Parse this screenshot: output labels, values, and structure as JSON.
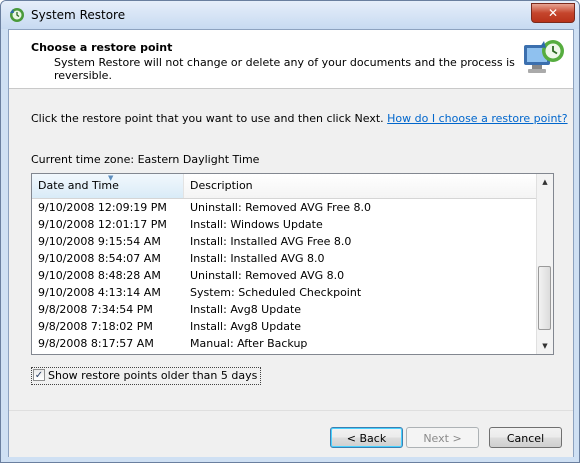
{
  "window": {
    "title": "System Restore",
    "close_label": "✕"
  },
  "header": {
    "title": "Choose a restore point",
    "subtitle": "System Restore will not change or delete any of your documents and the process is reversible."
  },
  "instruction": {
    "text": "Click the restore point that you want to use and then click Next.",
    "link": "How do I choose a restore point?"
  },
  "timezone": "Current time zone: Eastern Daylight Time",
  "table": {
    "columns": [
      "Date and Time",
      "Description"
    ],
    "rows": [
      {
        "date": "9/10/2008 12:09:19 PM",
        "desc": "Uninstall: Removed AVG Free 8.0"
      },
      {
        "date": "9/10/2008 12:01:17 PM",
        "desc": "Install: Windows Update"
      },
      {
        "date": "9/10/2008 9:15:54 AM",
        "desc": "Install: Installed AVG Free 8.0"
      },
      {
        "date": "9/10/2008 8:54:07 AM",
        "desc": "Install: Installed AVG 8.0"
      },
      {
        "date": "9/10/2008 8:48:28 AM",
        "desc": "Uninstall: Removed AVG 8.0"
      },
      {
        "date": "9/10/2008 4:13:14 AM",
        "desc": "System: Scheduled Checkpoint"
      },
      {
        "date": "9/8/2008 7:34:54 PM",
        "desc": "Install: Avg8 Update"
      },
      {
        "date": "9/8/2008 7:18:02 PM",
        "desc": "Install: Avg8 Update"
      },
      {
        "date": "9/8/2008 8:17:57 AM",
        "desc": "Manual: After Backup"
      }
    ]
  },
  "show_older": {
    "label": "Show restore points older than 5 days",
    "checked": true,
    "check_glyph": "✓"
  },
  "buttons": {
    "back": "< Back",
    "next": "Next >",
    "cancel": "Cancel"
  },
  "icons": {
    "title_icon": "system-restore-icon",
    "header_icon": "restore-computer-icon",
    "scroll_up": "▲",
    "scroll_down": "▼",
    "sort": "▼"
  },
  "colors": {
    "link": "#0066cc",
    "close_button": "#c5452c"
  }
}
